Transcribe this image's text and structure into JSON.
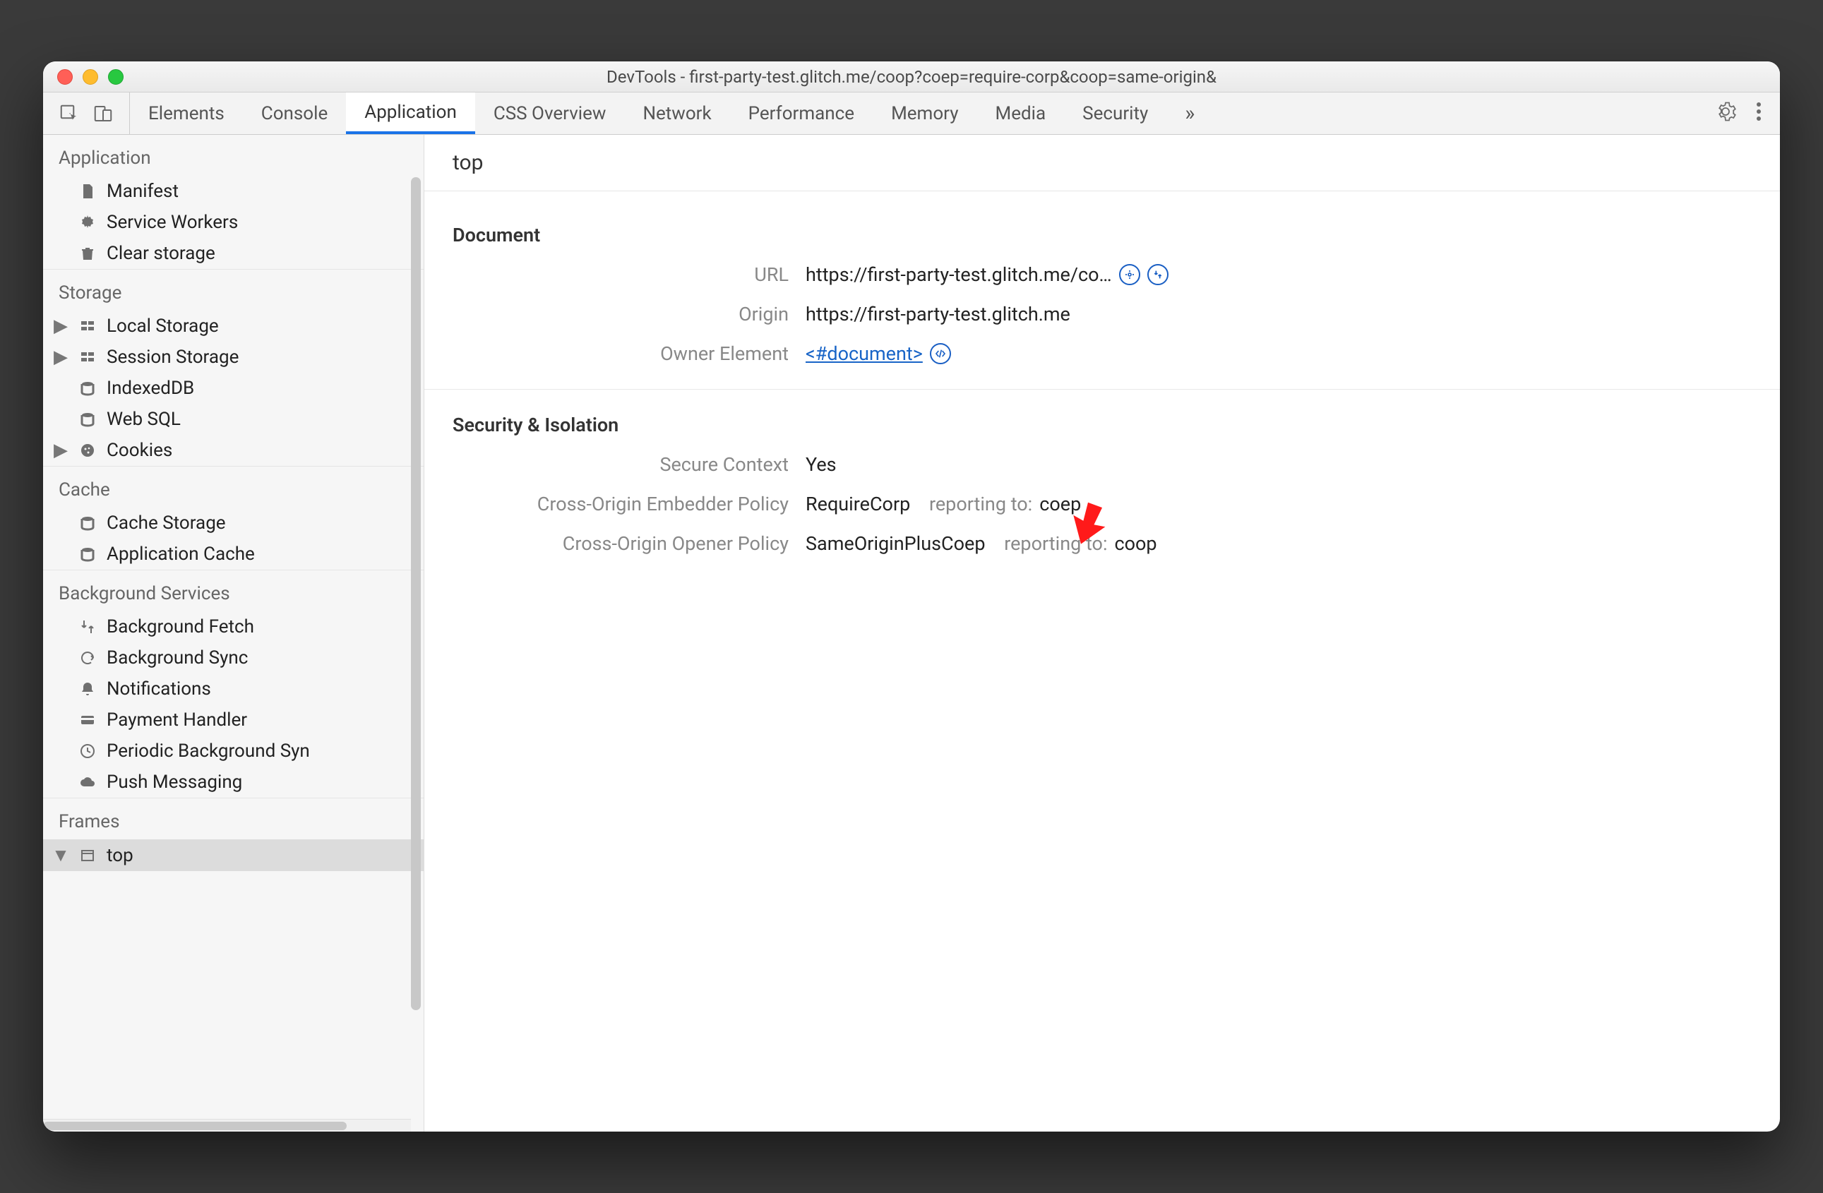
{
  "window": {
    "title": "DevTools - first-party-test.glitch.me/coop?coep=require-corp&coop=same-origin&"
  },
  "tabs": {
    "items": [
      {
        "label": "Elements"
      },
      {
        "label": "Console"
      },
      {
        "label": "Application",
        "active": true
      },
      {
        "label": "CSS Overview"
      },
      {
        "label": "Network"
      },
      {
        "label": "Performance"
      },
      {
        "label": "Memory"
      },
      {
        "label": "Media"
      },
      {
        "label": "Security"
      }
    ]
  },
  "sidebar": {
    "sections": [
      {
        "title": "Application",
        "items": [
          {
            "icon": "file",
            "label": "Manifest"
          },
          {
            "icon": "gear",
            "label": "Service Workers"
          },
          {
            "icon": "trash",
            "label": "Clear storage"
          }
        ]
      },
      {
        "title": "Storage",
        "items": [
          {
            "disclosure": true,
            "icon": "grid",
            "label": "Local Storage"
          },
          {
            "disclosure": true,
            "icon": "grid",
            "label": "Session Storage"
          },
          {
            "icon": "db",
            "label": "IndexedDB"
          },
          {
            "icon": "db",
            "label": "Web SQL"
          },
          {
            "disclosure": true,
            "icon": "cookie",
            "label": "Cookies"
          }
        ]
      },
      {
        "title": "Cache",
        "items": [
          {
            "icon": "db",
            "label": "Cache Storage"
          },
          {
            "icon": "db",
            "label": "Application Cache"
          }
        ]
      },
      {
        "title": "Background Services",
        "items": [
          {
            "icon": "fetch",
            "label": "Background Fetch"
          },
          {
            "icon": "sync",
            "label": "Background Sync"
          },
          {
            "icon": "bell",
            "label": "Notifications"
          },
          {
            "icon": "card",
            "label": "Payment Handler"
          },
          {
            "icon": "clock",
            "label": "Periodic Background Syn"
          },
          {
            "icon": "cloud",
            "label": "Push Messaging"
          }
        ]
      },
      {
        "title": "Frames",
        "items": [
          {
            "disclosure_open": true,
            "icon": "frame",
            "label": "top",
            "selected": true
          }
        ]
      }
    ]
  },
  "main": {
    "heading": "top",
    "document": {
      "section": "Document",
      "url_label": "URL",
      "url_value": "https://first-party-test.glitch.me/co…",
      "origin_label": "Origin",
      "origin_value": "https://first-party-test.glitch.me",
      "owner_label": "Owner Element",
      "owner_link": "<#document>"
    },
    "security": {
      "section": "Security & Isolation",
      "secure_label": "Secure Context",
      "secure_value": "Yes",
      "coep_label": "Cross-Origin Embedder Policy",
      "coep_value": "RequireCorp",
      "coep_report_prefix": "reporting to:",
      "coep_report_value": "coep",
      "coop_label": "Cross-Origin Opener Policy",
      "coop_value": "SameOriginPlusCoep",
      "coop_report_prefix": "reporting to:",
      "coop_report_value": "coop"
    }
  }
}
